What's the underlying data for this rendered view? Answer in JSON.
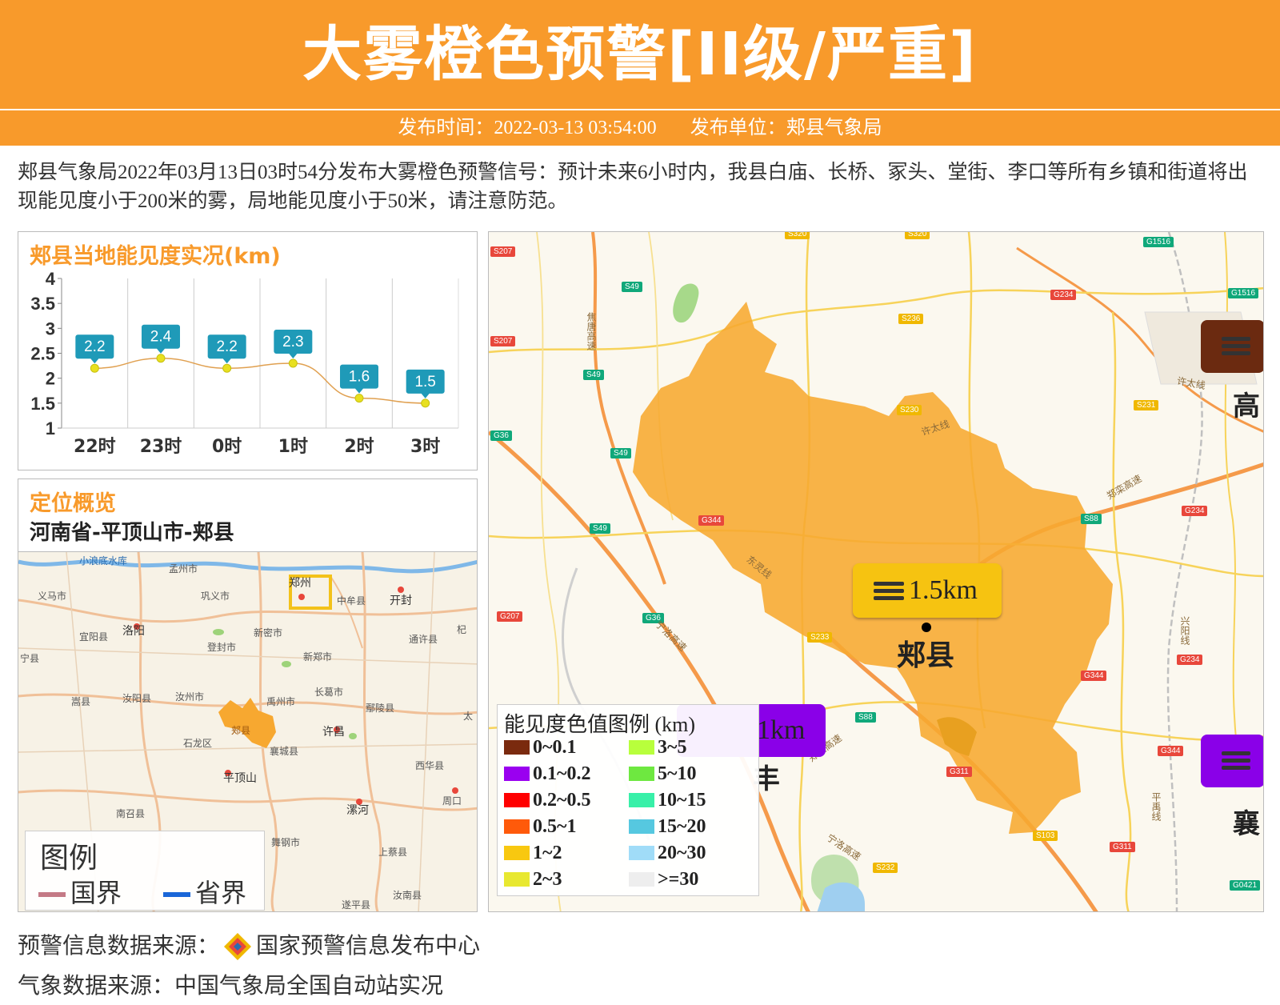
{
  "header": {
    "title": "大雾橙色预警[II级/严重]",
    "publish_time": "发布时间：2022-03-13 03:54:00",
    "publish_unit": "发布单位：郏县气象局"
  },
  "description": "郏县气象局2022年03月13日03时54分发布大雾橙色预警信号：预计未来6小时内，我县白庙、长桥、冢头、堂街、李口等所有乡镇和街道将出现能见度小于200米的雾，局地能见度小于50米，请注意防范。",
  "visibility_panel": {
    "title": "郏县当地能见度实况(km)"
  },
  "chart_data": {
    "type": "line",
    "title": "郏县当地能见度实况(km)",
    "categories": [
      "22时",
      "23时",
      "0时",
      "1时",
      "2时",
      "3时"
    ],
    "values": [
      2.2,
      2.4,
      2.2,
      2.3,
      1.6,
      1.5
    ],
    "ylim": [
      1,
      4
    ],
    "yticks": [
      "1",
      "1.5",
      "2",
      "2.5",
      "3",
      "3.5",
      "4"
    ],
    "grid": "vertical",
    "line_color": "#e0a050",
    "point_color": "#e8e020",
    "label_color": "#1f9ab8"
  },
  "location_panel": {
    "title": "定位概览",
    "path": "河南省-平顶山市-郏县",
    "places": [
      "小浪底水库",
      "孟州市",
      "郑州",
      "义马市",
      "巩义市",
      "中牟县",
      "开封",
      "洛阳",
      "宜阳县",
      "新密市",
      "通许县",
      "登封市",
      "新郑市",
      "杞",
      "长葛市",
      "嵩县",
      "汝阳县",
      "汝州市",
      "禹州市",
      "鄢陵县",
      "郏县",
      "许昌",
      "石龙区",
      "襄城县",
      "平顶山",
      "西华县",
      "周口",
      "南召县",
      "漯河",
      "舞钢市",
      "上蔡县",
      "遂平县",
      "汝南县",
      "太",
      "宁县"
    ],
    "legend_title": "图例",
    "legend_items": [
      {
        "label": "国界",
        "color": "#c47a86"
      },
      {
        "label": "省界",
        "color": "#1a66d8"
      }
    ]
  },
  "main_map": {
    "city": "郏县",
    "visibility_label": "1.5km",
    "partial_labels": [
      "1km",
      "高",
      "襄",
      "丰"
    ],
    "road_tags": [
      "S207",
      "S49",
      "S320",
      "G1516",
      "G234",
      "S236",
      "G36",
      "S230",
      "S231",
      "G344",
      "S88",
      "G207",
      "S233",
      "G311",
      "S103",
      "S232",
      "G0421"
    ],
    "road_names": [
      "焦唐高速",
      "许太线",
      "郑栾高速",
      "宁洛高速",
      "兴阳线",
      "平禹线",
      "东灵线"
    ],
    "legend": {
      "title": "能见度色值图例 (km)",
      "items": [
        {
          "label": "0~0.1",
          "color": "#7a2a0e"
        },
        {
          "label": "3~5",
          "color": "#b8ff3c"
        },
        {
          "label": "0.1~0.2",
          "color": "#9a00f0"
        },
        {
          "label": "5~10",
          "color": "#6ee840"
        },
        {
          "label": "0.2~0.5",
          "color": "#ff0000"
        },
        {
          "label": "10~15",
          "color": "#38f0a8"
        },
        {
          "label": "0.5~1",
          "color": "#ff5a0a"
        },
        {
          "label": "15~20",
          "color": "#56c8e0"
        },
        {
          "label": "1~2",
          "color": "#f8c810"
        },
        {
          "label": "20~30",
          "color": "#a0dcf8"
        },
        {
          "label": "2~3",
          "color": "#e8e830"
        },
        {
          "label": ">=30",
          "color": "#eeeeee"
        }
      ]
    }
  },
  "footer": {
    "warning_source": "预警信息数据来源：",
    "warning_source_name": "国家预警信息发布中心",
    "weather_source": "气象数据来源：中国气象局全国自动站实况"
  },
  "colors": {
    "orange": "#f89a2b",
    "county_fill": "#f7a830",
    "bubble_yellow": "#f6c311"
  }
}
